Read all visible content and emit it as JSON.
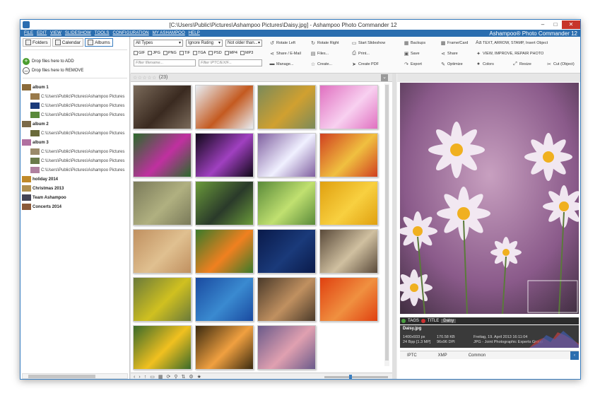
{
  "window": {
    "title": "[C:\\Users\\Public\\Pictures\\Ashampoo Pictures\\Daisy.jpg] - Ashampoo Photo Commander 12",
    "minimize": "–",
    "maximize": "□",
    "close": "✕"
  },
  "menu": {
    "items": [
      "FILE",
      "EDIT",
      "VIEW",
      "SLIDESHOW",
      "TOOLS",
      "CONFIGURATION",
      "MY ASHAMPOO",
      "HELP"
    ],
    "brand": "Ashampoo® Photo Commander 12"
  },
  "left": {
    "tabs": {
      "folders": "Folders",
      "calendar": "Calendar",
      "albums": "Albums"
    },
    "add_label": "Drop files here to ADD",
    "remove_label": "Drop files here to REMOVE",
    "tree": [
      {
        "label": "album 1",
        "level": 0,
        "color": "#8a6a3a"
      },
      {
        "label": "C:\\Users\\Public\\Pictures\\Ashampoo Pictures",
        "level": 1,
        "color": "#9a7a4a"
      },
      {
        "label": "C:\\Users\\Public\\Pictures\\Ashampoo Pictures",
        "level": 1,
        "color": "#1a3a7a"
      },
      {
        "label": "C:\\Users\\Public\\Pictures\\Ashampoo Pictures",
        "level": 1,
        "color": "#5a8a3a"
      },
      {
        "label": "album 2",
        "level": 0,
        "color": "#7a6a4a"
      },
      {
        "label": "C:\\Users\\Public\\Pictures\\Ashampoo Pictures",
        "level": 1,
        "color": "#6a6a3a"
      },
      {
        "label": "album 3",
        "level": 0,
        "color": "#b070a0"
      },
      {
        "label": "C:\\Users\\Public\\Pictures\\Ashampoo Pictures",
        "level": 1,
        "color": "#9a8a6a"
      },
      {
        "label": "C:\\Users\\Public\\Pictures\\Ashampoo Pictures",
        "level": 1,
        "color": "#6a7a4a"
      },
      {
        "label": "C:\\Users\\Public\\Pictures\\Ashampoo Pictures",
        "level": 1,
        "color": "#b080a0"
      },
      {
        "label": "holiday 2014",
        "level": 0,
        "color": "#c08a2a"
      },
      {
        "label": "Christmas 2013",
        "level": 0,
        "color": "#b09050"
      },
      {
        "label": "Team Ashampoo",
        "level": 0,
        "color": "#444455"
      },
      {
        "label": "Concerts 2014",
        "level": 0,
        "color": "#8a5a3a"
      }
    ]
  },
  "toolbar": {
    "types": "All Types",
    "rating": "Ignore Rating",
    "age": "Not older than...",
    "checks": [
      "GIF",
      "JPG",
      "PNG",
      "TIF",
      "TGA",
      "PSD",
      "MP4",
      "MP3"
    ],
    "filter_filename": "Filter filename...",
    "filter_iptc": "Filter IPTC/EXIF...",
    "rotate_left": "Rotate Left",
    "rotate_right": "Rotate Right",
    "share_email": "Share / E-Mail",
    "files": "Files...",
    "manage": "Manage...",
    "create": "Create...",
    "start_slideshow": "Start Slideshow",
    "print": "Print...",
    "create_pdf": "Create PDF",
    "backups": "Backups",
    "save": "Save",
    "export": "Export",
    "frame_card": "Frame/Card",
    "share": "Share",
    "optimize": "Optimize",
    "text_arrow": "TEXT, ARROW, STAMP, Insert Object",
    "view_improve": "VIEW, IMPROVE, REPAIR PHOTO",
    "colors": "Colors",
    "resize": "Resize",
    "cut": "Cut (Object)"
  },
  "grid": {
    "stars": "☆☆☆☆☆",
    "count": "(23)",
    "collapse": "⌄",
    "tiles": [
      {
        "a": "#7a6a5a",
        "b": "#3a2a20"
      },
      {
        "a": "#e8eef4",
        "b": "#c45a20"
      },
      {
        "a": "#7a8a5a",
        "b": "#d0a030"
      },
      {
        "a": "#e070c0",
        "b": "#f8d0f0"
      },
      {
        "a": "#2a6a2a",
        "b": "#c030a0"
      },
      {
        "a": "#100818",
        "b": "#a040c0"
      },
      {
        "a": "#8060a0",
        "b": "#f0f0ff"
      },
      {
        "a": "#d04020",
        "b": "#f0c040"
      },
      {
        "a": "#7a7a5a",
        "b": "#b0b080"
      },
      {
        "a": "#6a9a3a",
        "b": "#2a3a2a"
      },
      {
        "a": "#5a8a3a",
        "b": "#c0e070"
      },
      {
        "a": "#e0a010",
        "b": "#f8d040"
      },
      {
        "a": "#c09060",
        "b": "#e0c090"
      },
      {
        "a": "#3a7a2a",
        "b": "#f08020"
      },
      {
        "a": "#0a1a4a",
        "b": "#1a3a7a"
      },
      {
        "a": "#5a4a3a",
        "b": "#d0c0a0"
      },
      {
        "a": "#6a7a3a",
        "b": "#d0c020"
      },
      {
        "a": "#1a4aa0",
        "b": "#3a8ad0"
      },
      {
        "a": "#4a3a2a",
        "b": "#c09060"
      },
      {
        "a": "#e04010",
        "b": "#f09040"
      },
      {
        "a": "#3a6a2a",
        "b": "#f0c020"
      },
      {
        "a": "#3a2a10",
        "b": "#f0a040"
      },
      {
        "a": "#6a5a8a",
        "b": "#e0a0b0"
      }
    ]
  },
  "preview": {
    "tags": "TAGS",
    "title": "TITLE",
    "title_value": "Daisy",
    "filename": "Daisy.jpg",
    "dims": "1400x933 px",
    "bpp": "24 Bpp [1.3 MP]",
    "size": "170.58 KB",
    "dpi": "96x96 DPI",
    "date": "Freitag, 19. April 2013 16:11:04",
    "format": "JPG - Joint Photographic Experts Group",
    "tab_iptc": "IPTC",
    "tab_xmp": "XMP",
    "tab_common": "Common",
    "corner": "‹"
  }
}
